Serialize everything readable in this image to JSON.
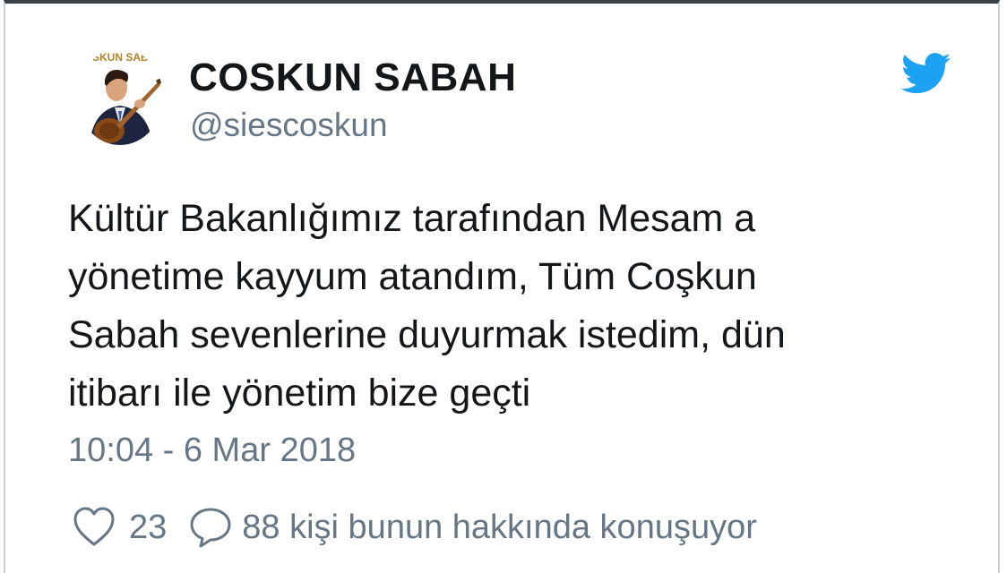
{
  "tweet": {
    "display_name": "COSKUN SABAH",
    "handle": "@siescoskun",
    "avatar_caption": "COSKUN SABAH",
    "text_lines": [
      "Kültür Bakanlığımız tarafından Mesam a",
      "yönetime kayyum atandım, Tüm Coşkun",
      "Sabah sevenlerine duyurmak istedim, dün",
      "itibarı ile yönetim bize geçti"
    ],
    "timestamp": "10:04 - 6 Mar 2018",
    "like_count": "23",
    "conversation_text": "88 kişi bunun hakkında konuşuyor"
  },
  "icons": {
    "brand": "twitter-bird-icon",
    "like": "heart-icon",
    "reply": "speech-bubble-icon"
  },
  "colors": {
    "brand": "#1da1f2",
    "text": "#14171a",
    "secondary": "#657786",
    "border": "#c9d0d6",
    "top_bar": "#3d4246"
  }
}
